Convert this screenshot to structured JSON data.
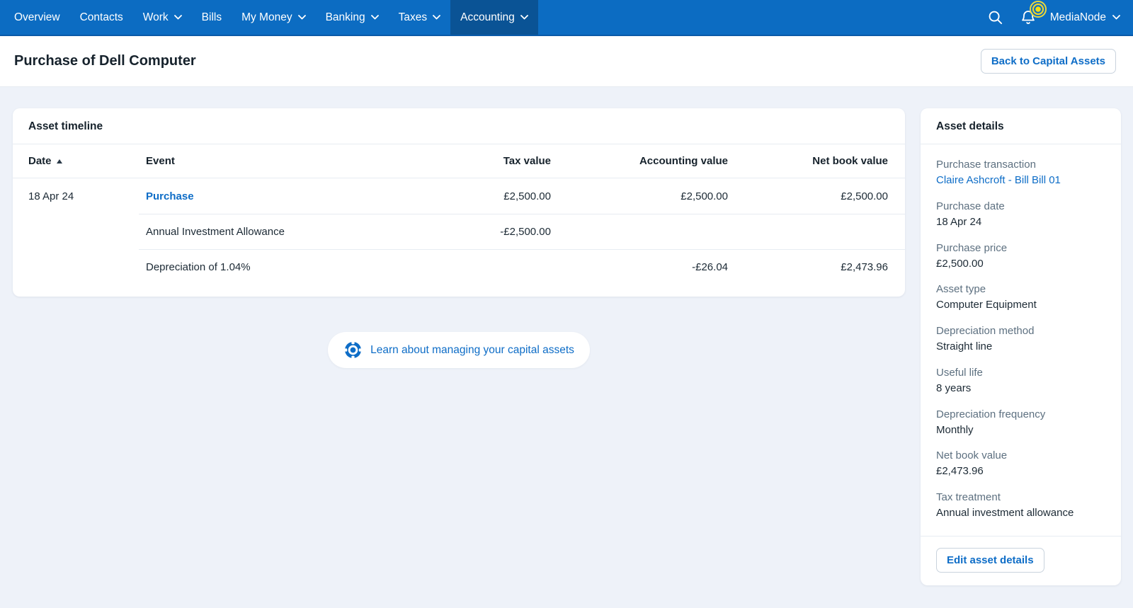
{
  "nav": {
    "items": [
      {
        "label": "Overview",
        "has_dropdown": false,
        "active": false
      },
      {
        "label": "Contacts",
        "has_dropdown": false,
        "active": false
      },
      {
        "label": "Work",
        "has_dropdown": true,
        "active": false
      },
      {
        "label": "Bills",
        "has_dropdown": false,
        "active": false
      },
      {
        "label": "My Money",
        "has_dropdown": true,
        "active": false
      },
      {
        "label": "Banking",
        "has_dropdown": true,
        "active": false
      },
      {
        "label": "Taxes",
        "has_dropdown": true,
        "active": false
      },
      {
        "label": "Accounting",
        "has_dropdown": true,
        "active": true
      }
    ],
    "account_label": "MediaNode",
    "icons": {
      "search": "magnifier",
      "notifications": "bell-with-alert-badge",
      "account": "chevron-down"
    }
  },
  "header": {
    "title": "Purchase of Dell Computer",
    "back_button": "Back to Capital Assets"
  },
  "timeline": {
    "title": "Asset timeline",
    "columns": [
      "Date",
      "Event",
      "Tax value",
      "Accounting value",
      "Net book value"
    ],
    "sort": {
      "column": "Date",
      "direction": "ascending"
    },
    "rows": [
      {
        "date": "18 Apr 24",
        "event": "Purchase",
        "event_is_link": true,
        "tax": "£2,500.00",
        "accounting": "£2,500.00",
        "net": "£2,500.00"
      },
      {
        "date": "",
        "event": "Annual Investment Allowance",
        "event_is_link": false,
        "tax": "-£2,500.00",
        "accounting": "",
        "net": ""
      },
      {
        "date": "",
        "event": "Depreciation of 1.04%",
        "event_is_link": false,
        "tax": "",
        "accounting": "-£26.04",
        "net": "£2,473.96"
      }
    ]
  },
  "learn_link": {
    "icon": "life-ring",
    "label": "Learn about managing your capital assets"
  },
  "asset_details": {
    "title": "Asset details",
    "fields": [
      {
        "label": "Purchase transaction",
        "value": "Claire Ashcroft - Bill Bill 01",
        "is_link": true
      },
      {
        "label": "Purchase date",
        "value": "18 Apr 24"
      },
      {
        "label": "Purchase price",
        "value": "£2,500.00"
      },
      {
        "label": "Asset type",
        "value": "Computer Equipment"
      },
      {
        "label": "Depreciation method",
        "value": "Straight line"
      },
      {
        "label": "Useful life",
        "value": "8 years"
      },
      {
        "label": "Depreciation frequency",
        "value": "Monthly"
      },
      {
        "label": "Net book value",
        "value": "£2,473.96"
      },
      {
        "label": "Tax treatment",
        "value": "Annual investment allowance"
      }
    ],
    "edit_button": "Edit asset details"
  },
  "colors": {
    "nav_background": "#0c6cc2",
    "nav_active_background": "#0a5395",
    "link": "#0e6dc7",
    "page_background": "#eef2f9",
    "notification_badge": "#f4de12",
    "label_gray": "#5d7080",
    "text_dark": "#1c2a35",
    "divider": "#e7ecf2"
  }
}
